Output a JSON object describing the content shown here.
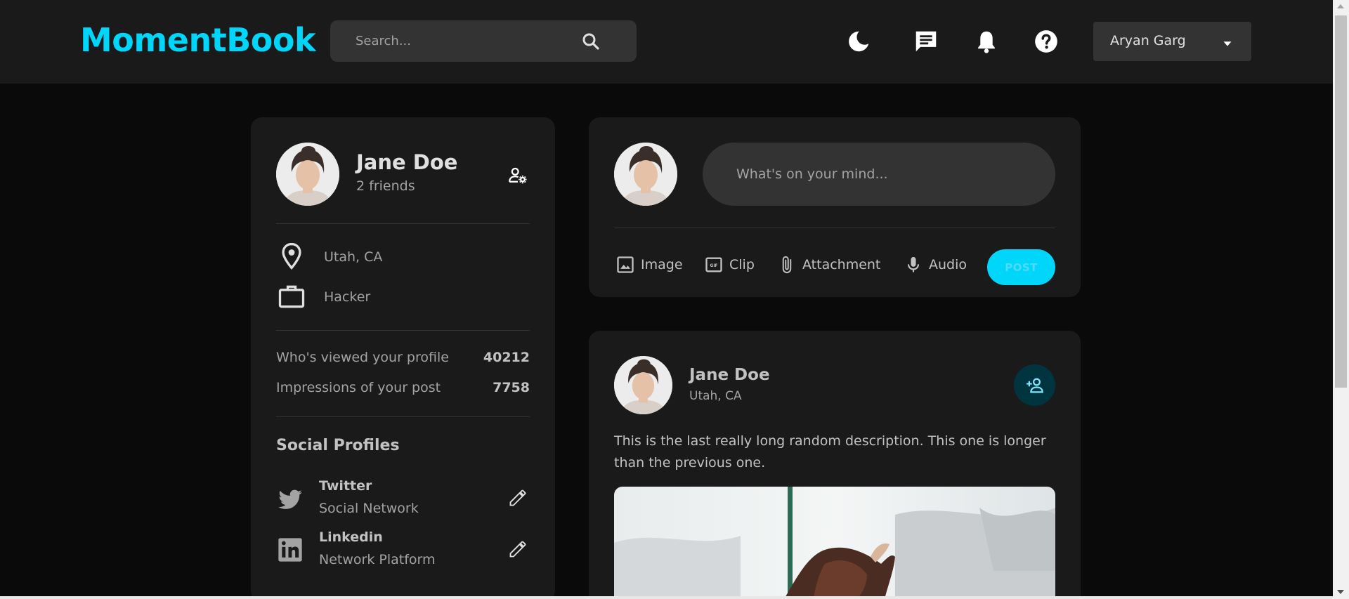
{
  "navbar": {
    "logo": "MomentBook",
    "search_placeholder": "Search...",
    "icons": [
      "dark-mode-icon",
      "message-icon",
      "notification-icon",
      "help-icon"
    ],
    "user_name": "Aryan Garg"
  },
  "profile": {
    "name": "Jane Doe",
    "friends": "2 friends",
    "location": "Utah, CA",
    "occupation": "Hacker",
    "stats": [
      {
        "label": "Who's viewed your profile",
        "value": "40212"
      },
      {
        "label": "Impressions of your post",
        "value": "7758"
      }
    ],
    "social_title": "Social Profiles",
    "socials": [
      {
        "name": "Twitter",
        "sub": "Social Network",
        "icon": "twitter-icon"
      },
      {
        "name": "Linkedin",
        "sub": "Network Platform",
        "icon": "linkedin-icon"
      }
    ]
  },
  "create_post": {
    "placeholder": "What's on your mind...",
    "tools": [
      {
        "label": "Image",
        "icon": "image-icon"
      },
      {
        "label": "Clip",
        "icon": "gif-icon"
      },
      {
        "label": "Attachment",
        "icon": "attachment-icon"
      },
      {
        "label": "Audio",
        "icon": "mic-icon"
      }
    ],
    "post_label": "POST"
  },
  "feed": {
    "author": "Jane Doe",
    "location": "Utah, CA",
    "description": "This is the last really long random description. This one is longer than the previous one."
  },
  "colors": {
    "accent": "#00d5fa",
    "background": "#0a0a0a",
    "card": "#1a1a1a",
    "input": "#333333"
  }
}
